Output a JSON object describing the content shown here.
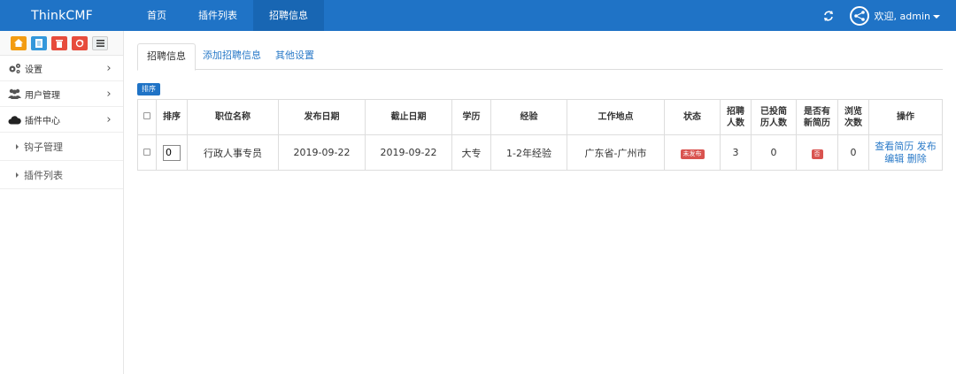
{
  "navbar": {
    "brand": "ThinkCMF",
    "items": [
      "首页",
      "插件列表",
      "招聘信息"
    ],
    "welcome": "欢迎, admin"
  },
  "sidebar": {
    "shortcuts": [
      "home-icon",
      "file-icon",
      "trash-icon",
      "recycle-icon",
      "list-icon"
    ],
    "menu": [
      {
        "label": "设置",
        "icon": "gears-icon"
      },
      {
        "label": "用户管理",
        "icon": "users-icon"
      },
      {
        "label": "插件中心",
        "icon": "cloud-icon"
      }
    ],
    "sub_items": [
      "钩子管理",
      "插件列表"
    ]
  },
  "tabs": [
    "招聘信息",
    "添加招聘信息",
    "其他设置"
  ],
  "sort_button": "排序",
  "table": {
    "headers": {
      "order": "排序",
      "title": "职位名称",
      "publish_date": "发布日期",
      "deadline": "截止日期",
      "education": "学历",
      "experience": "经验",
      "location": "工作地点",
      "status": "状态",
      "hires_1": "招聘",
      "hires_2": "人数",
      "applied_1": "已投简",
      "applied_2": "历人数",
      "new_resume_1": "是否有",
      "new_resume_2": "新简历",
      "views_1": "浏览",
      "views_2": "次数",
      "actions": "操作"
    },
    "rows": [
      {
        "order": "0",
        "title": "行政人事专员",
        "publish_date": "2019-09-22",
        "deadline": "2019-09-22",
        "education": "大专",
        "experience": "1-2年经验",
        "location": "广东省-广州市",
        "status": "未发布",
        "hires": "3",
        "applied": "0",
        "new_resume": "否",
        "views": "0",
        "action_view": "查看简历",
        "action_publish": "发布",
        "action_edit": "编辑",
        "action_delete": "删除"
      }
    ]
  },
  "colors": {
    "navbar": "#1f73c6",
    "link": "#2a7ac8",
    "danger": "#d9534f"
  }
}
